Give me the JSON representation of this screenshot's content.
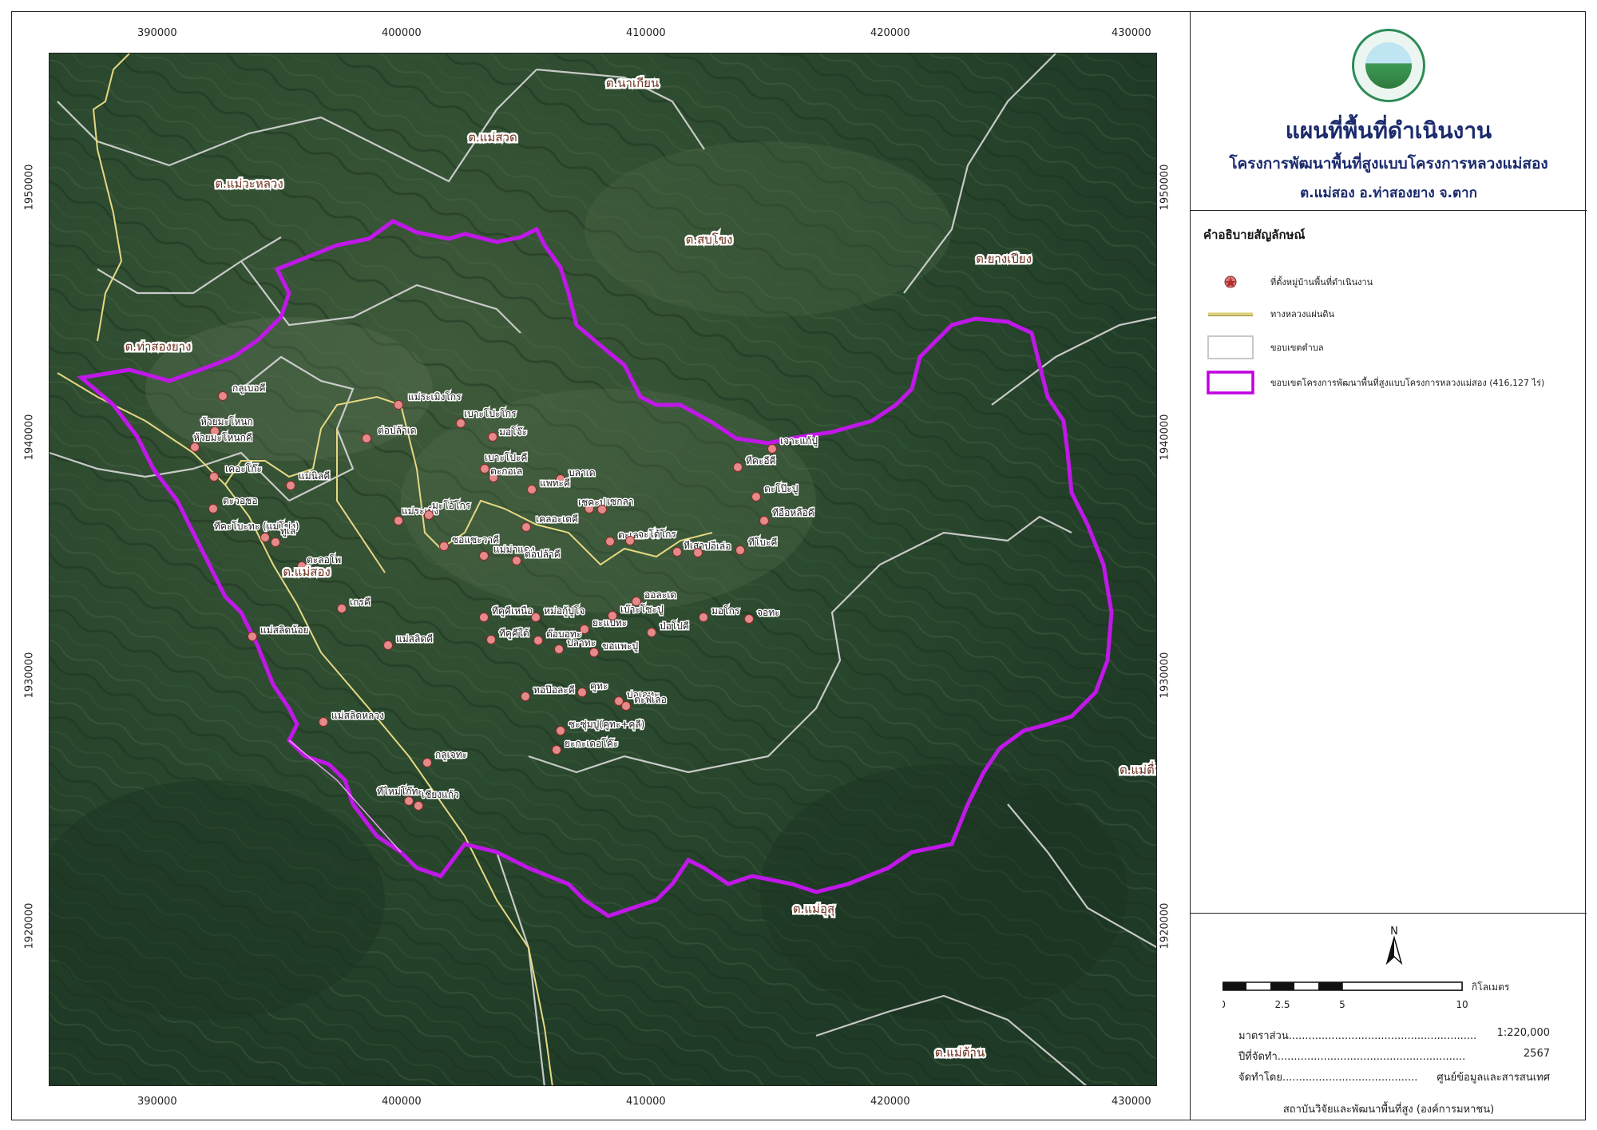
{
  "title": {
    "main": "แผนที่พื้นที่ดำเนินงาน",
    "sub": "โครงการพัฒนาพื้นที่สูงแบบโครงการหลวงแม่สอง",
    "location": "ต.แม่สอง อ.ท่าสองยาง จ.ตาก"
  },
  "legend": {
    "heading": "คำอธิบายสัญลักษณ์",
    "items": [
      {
        "label": "ที่ตั้งหมู่บ้านพื้นที่ดำเนินงาน",
        "symbol": "village-marker",
        "color": "#e07a7a"
      },
      {
        "label": "ทางหลวงแผ่นดิน",
        "symbol": "highway-line",
        "color": "#d8cc6a"
      },
      {
        "label": "ขอบเขตตำบล",
        "symbol": "subdistrict-boundary",
        "color": "#c8c8c8"
      },
      {
        "label": "ขอบเขตโครงการพัฒนาพื้นที่สูงแบบโครงการหลวงแม่สอง (416,127 ไร่)",
        "symbol": "project-boundary",
        "color": "#c000e0"
      }
    ]
  },
  "scale": {
    "north": "N",
    "unit": "กิโลเมตร",
    "ticks": [
      "0",
      "2.5",
      "5",
      "10"
    ],
    "info": [
      {
        "label": "มาตราส่วน.........................................................",
        "value": "1:220,000"
      },
      {
        "label": "ปีที่จัดทำ.........................................................",
        "value": "2567"
      },
      {
        "label": "จัดทำโดย.........................................",
        "value": "ศูนย์ข้อมูลและสารสนเทศ"
      }
    ],
    "footer": "สถาบันวิจัยและพัฒนาพื้นที่สูง (องค์การมหาชน)"
  },
  "grid": {
    "x_labels": [
      "390000",
      "400000",
      "410000",
      "420000",
      "430000"
    ],
    "y_labels": [
      "1950000",
      "1940000",
      "1930000",
      "1920000"
    ]
  },
  "subdistricts": [
    "ต.นาเกียน",
    "ต.แม่สวด",
    "ต.แม่วะหลวง",
    "ต.สบโขง",
    "ต.ยางเปียง",
    "ต.ท่าสองยาง",
    "ต.แม่สอง",
    "ต.แม่ตื่น",
    "ต.แม่อุสุ",
    "ต.แม่ต้าน"
  ],
  "villages": [
    "กลูเบอคี",
    "ห้วยมะโหนก",
    "ห้วยมะโหนกคี",
    "เคอะโก๊ะ",
    "ตะวอชอ",
    "ทีคะโบะทะ (แม่โข่ง)",
    "ทูเล",
    "แม่นิลคี",
    "ต่อปล้าเด",
    "แม่ระเมิงโกร",
    "เบาะโปะโกร",
    "มอโจ๊ะ",
    "เบาะโปะคี",
    "ตะกอเล",
    "บลาเด",
    "แพทะคี",
    "เชคะปู",
    "เซกลา",
    "แม่ระเมิง",
    "มะโอ๊โกร",
    "เคลอะเดคี",
    "ตะเลอะโจ",
    "จะโด้โกร",
    "ทีเสาะคี",
    "ปอเล่อ",
    "ทีคะอีคี",
    "เจาะแก้ปู",
    "ตะโป๊ะปู",
    "ทีอือหลือคี",
    "ทีโบะคี",
    "ซอแซะวาคี",
    "แม่ม่าแดง",
    "ต่อปล้าคี",
    "ตะลอโพ",
    "เกรคี",
    "ทีคูคีเหนือ",
    "หม่อกู้ปูโจ",
    "ยะแปทะ",
    "เบ๊าะโซะปู",
    "ออละเด",
    "ทีคูคีใต้",
    "ต๊อบอทะ",
    "ปลาทะ",
    "ขอแพะปู",
    "ป่อโปคี",
    "มอโกร",
    "จอทะ",
    "แม่สลิดน้อย",
    "แม่สลิดคี",
    "ทอป๊อละคี",
    "คูทะ",
    "บ่อเลทะ",
    "ตะพิเลอ",
    "แม่สลิดหลวง",
    "ซะซุ่มปู(คูทะ+คุลี)",
    "ยะกะเดอโค๊ะ",
    "กลูเจทะ",
    "ทีไหม่โก๊ทะ",
    "เชียงแก้ว"
  ]
}
